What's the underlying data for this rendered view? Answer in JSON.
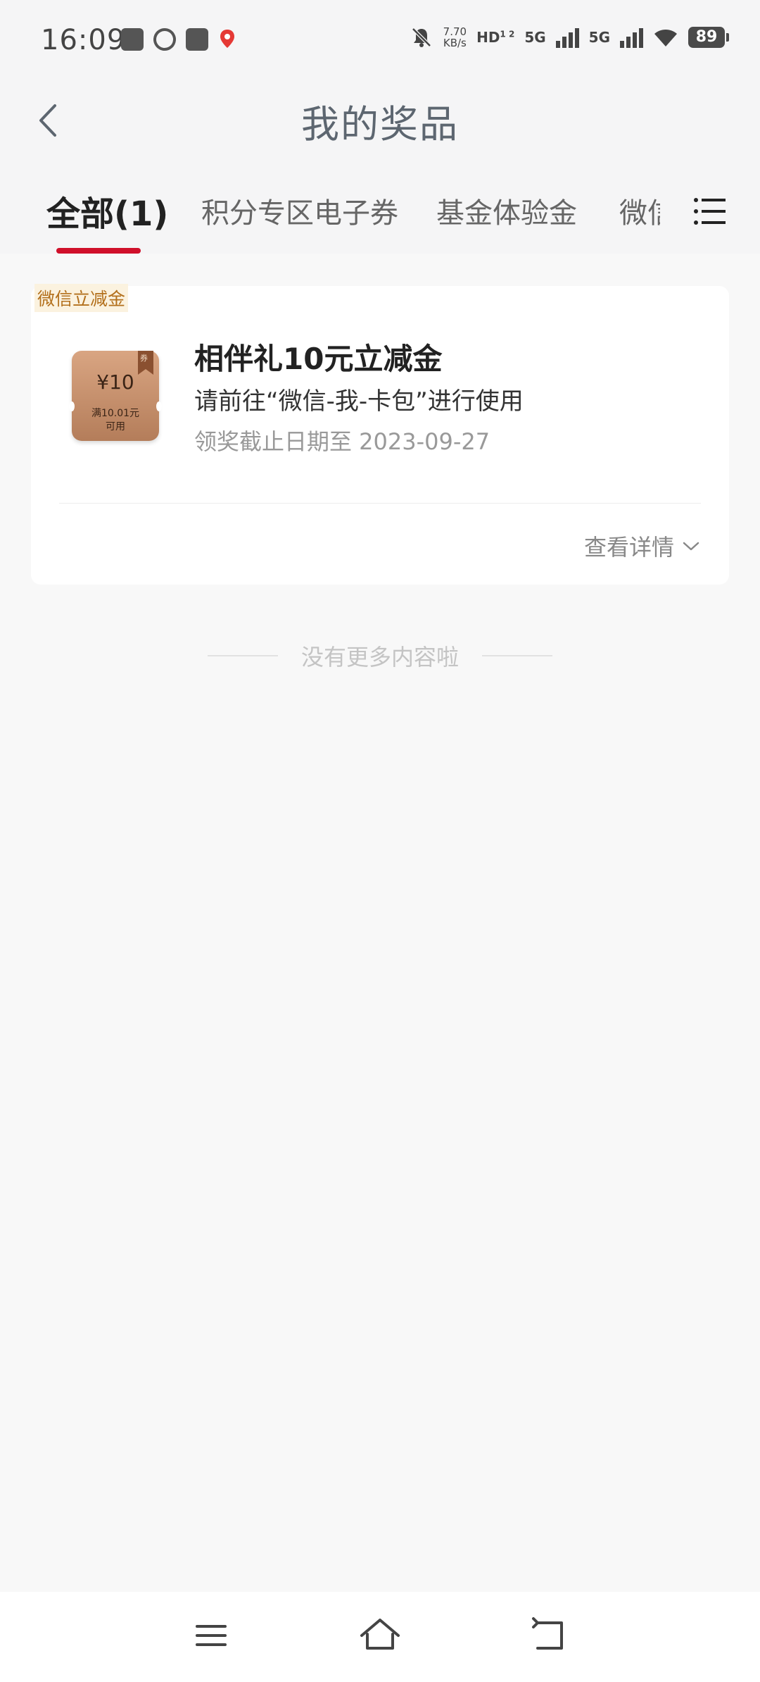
{
  "status_bar": {
    "time": "16:09",
    "net_speed_value": "7.70",
    "net_speed_unit": "KB/s",
    "hd_label": "HD",
    "hd_sub": "1 2",
    "signal1_label": "5G",
    "signal2_label": "5G",
    "battery": "89",
    "icons": [
      "notification-app-icon",
      "notification-app-icon-2",
      "notification-mail-icon",
      "notification-map-icon",
      "mute-bell-icon",
      "wifi-icon"
    ]
  },
  "header": {
    "title": "我的奖品",
    "back_icon": "chevron-left-icon"
  },
  "tabs": {
    "items": [
      {
        "label": "全部(1)",
        "active": true
      },
      {
        "label": "积分专区电子券",
        "active": false
      },
      {
        "label": "基金体验金",
        "active": false
      },
      {
        "label": "微信",
        "active": false
      }
    ],
    "menu_icon": "list-menu-icon",
    "accent_color": "#d0102a"
  },
  "prize_card": {
    "tag": "微信立减金",
    "coupon_amount": "¥10",
    "coupon_condition_line1": "满10.01元",
    "coupon_condition_line2": "可用",
    "coupon_flag": "券",
    "title": "相伴礼10元立减金",
    "description": "请前往“微信-我-卡包”进行使用",
    "deadline": "领奖截止日期至 2023-09-27",
    "detail_label": "查看详情"
  },
  "footer_text": "没有更多内容啦",
  "nav_bar": {
    "icons": [
      "menu-icon",
      "home-icon",
      "back-icon"
    ]
  }
}
